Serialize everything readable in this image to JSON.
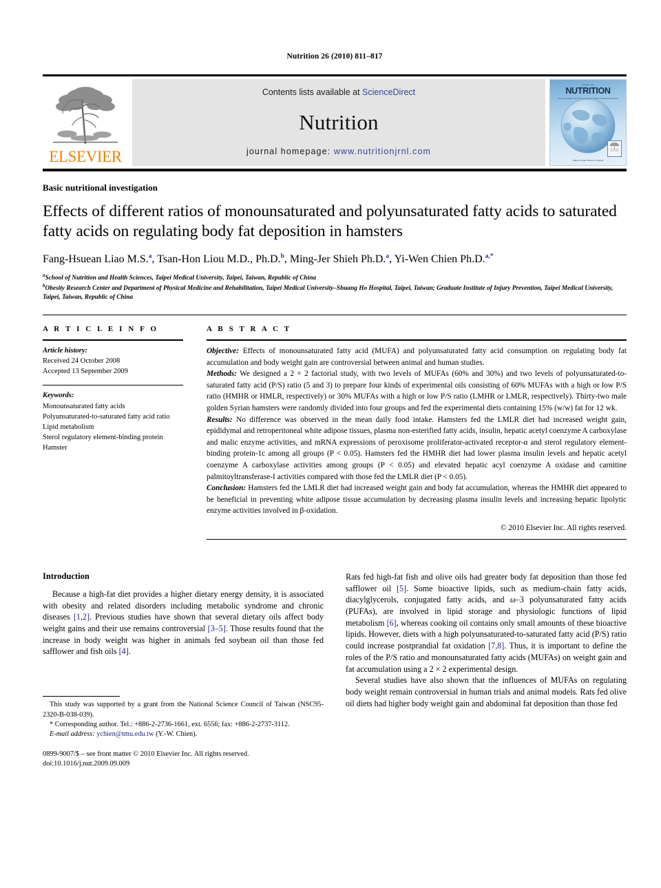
{
  "running_head": "Nutrition 26 (2010) 811–817",
  "masthead": {
    "publisher_name": "ELSEVIER",
    "contents_prefix": "Contents lists available at ",
    "contents_link": "ScienceDirect",
    "journal_title": "Nutrition",
    "homepage_prefix": "journal homepage: ",
    "homepage_url": "www.nutritionjrnl.com",
    "cover": {
      "top_label": "Volume 26",
      "title": "NUTRITION",
      "subtitle": "The International Journal of Applied and Basic Nutritional Sciences",
      "bottom_label": "Editor-in-Chief: Michel M. Meguid",
      "publisher_mark": "ELSEVIER"
    },
    "colors": {
      "link": "#33449b",
      "elsevier_orange": "#F08000",
      "masthead_gray": "#e4e4e4",
      "cover_blue": "#6fa8d8"
    }
  },
  "article": {
    "section_label": "Basic nutritional investigation",
    "title": "Effects of different ratios of monounsaturated and polyunsaturated fatty acids to saturated fatty acids on regulating body fat deposition in hamsters",
    "authors": [
      {
        "name": "Fang-Hsuean Liao M.S.",
        "marks": "a",
        "sep": ", "
      },
      {
        "name": "Tsan-Hon Liou M.D., Ph.D.",
        "marks": "b",
        "sep": ", "
      },
      {
        "name": "Ming-Jer Shieh Ph.D.",
        "marks": "a",
        "sep": ", "
      },
      {
        "name": "Yi-Wen Chien Ph.D.",
        "marks": "a,*",
        "sep": ""
      }
    ],
    "affiliations": [
      {
        "mark": "a",
        "text": "School of Nutrition and Health Sciences, Taipei Medical University, Taipei, Taiwan, Republic of China"
      },
      {
        "mark": "b",
        "text": "Obesity Research Center and Department of Physical Medicine and Rehabilitation, Taipei Medical University–Shuang Ho Hospital, Taipei, Taiwan; Graduate Institute of Injury Prevention, Taipei Medical University, Taipei, Taiwan, Republic of China"
      }
    ]
  },
  "article_info": {
    "heading": "A R T I C L E  I N F O",
    "history_label": "Article history:",
    "history": [
      "Received 24 October 2008",
      "Accepted 13 September 2009"
    ],
    "keywords_label": "Keywords:",
    "keywords": [
      "Monounsaturated fatty acids",
      "Polyunsaturated-to-saturated fatty acid ratio",
      "Lipid metabolism",
      "Sterol regulatory element-binding protein",
      "Hamster"
    ]
  },
  "abstract": {
    "heading": "A B S T R A C T",
    "objective_label": "Objective:",
    "objective_text": " Effects of monounsaturated fatty acid (MUFA) and polyunsaturated fatty acid consumption on regulating body fat accumulation and body weight gain are controversial between animal and human studies.",
    "methods_label": "Methods:",
    "methods_text": " We designed a 2 × 2 factorial study, with two levels of MUFAs (60% and 30%) and two levels of polyunsaturated-to-saturated fatty acid (P/S) ratio (5 and 3) to prepare four kinds of experimental oils consisting of 60% MUFAs with a high or low P/S ratio (HMHR or HMLR, respectively) or 30% MUFAs with a high or low P/S ratio (LMHR or LMLR, respectively). Thirty-two male golden Syrian hamsters were randomly divided into four groups and fed the experimental diets containing 15% (w/w) fat for 12 wk.",
    "results_label": "Results:",
    "results_text": " No difference was observed in the mean daily food intake. Hamsters fed the LMLR diet had increased weight gain, epididymal and retroperitoneal white adipose tissues, plasma non-esterified fatty acids, insulin, hepatic acetyl coenzyme A carboxylase and malic enzyme activities, and mRNA expressions of peroxisome proliferator-activated receptor-α and sterol regulatory element-binding protein-1c among all groups (P < 0.05). Hamsters fed the HMHR diet had lower plasma insulin levels and hepatic acetyl coenzyme A carboxylase activities among groups (P < 0.05) and elevated hepatic acyl coenzyme A oxidase and carnitine palmitoyltransferase-I activities compared with those fed the LMLR diet (P < 0.05).",
    "conclusion_label": "Conclusion:",
    "conclusion_text": " Hamsters fed the LMLR diet had increased weight gain and body fat accumulation, whereas the HMHR diet appeared to be beneficial in preventing white adipose tissue accumulation by decreasing plasma insulin levels and increasing hepatic lipolytic enzyme activities involved in β-oxidation.",
    "copyright": "© 2010 Elsevier Inc. All rights reserved."
  },
  "introduction": {
    "heading": "Introduction",
    "left_paragraphs": [
      {
        "segments": [
          {
            "t": "Because a high-fat diet provides a higher dietary energy density, it is associated with obesity and related disorders including metabolic syndrome and chronic diseases ",
            "ref": false
          },
          {
            "t": "[1,2]",
            "ref": true
          },
          {
            "t": ". Previous studies have shown that several dietary oils affect body weight gains and their use remains controversial ",
            "ref": false
          },
          {
            "t": "[3–5]",
            "ref": true
          },
          {
            "t": ". Those results found that the increase in body weight was higher in animals fed soybean oil than those fed safflower and fish oils ",
            "ref": false
          },
          {
            "t": "[4]",
            "ref": true
          },
          {
            "t": ".",
            "ref": false
          }
        ]
      }
    ],
    "right_paragraphs": [
      {
        "indent": false,
        "segments": [
          {
            "t": "Rats fed high-fat fish and olive oils had greater body fat deposition than those fed safflower oil ",
            "ref": false
          },
          {
            "t": "[5]",
            "ref": true
          },
          {
            "t": ". Some bioactive lipids, such as medium-chain fatty acids, diacylglycerols, conjugated fatty acids, and ω–3 polyunsaturated fatty acids (PUFAs), are involved in lipid storage and physiologic functions of lipid metabolism ",
            "ref": false
          },
          {
            "t": "[6]",
            "ref": true
          },
          {
            "t": ", whereas cooking oil contains only small amounts of these bioactive lipids. However, diets with a high polyunsaturated-to-saturated fatty acid (P/S) ratio could increase postprandial fat oxidation ",
            "ref": false
          },
          {
            "t": "[7,8]",
            "ref": true
          },
          {
            "t": ". Thus, it is important to define the roles of the P/S ratio and monounsaturated fatty acids (MUFAs) on weight gain and fat accumulation using a 2 × 2 experimental design.",
            "ref": false
          }
        ]
      },
      {
        "indent": true,
        "segments": [
          {
            "t": "Several studies have also shown that the influences of MUFAs on regulating body weight remain controversial in human trials and animal models. Rats fed olive oil diets had higher body weight gain and abdominal fat deposition than those fed",
            "ref": false
          }
        ]
      }
    ]
  },
  "footnotes": {
    "grant": "This study was supported by a grant from the National Science Council of Taiwan (NSC95-2320-B-038-039).",
    "corresponding": "* Corresponding author. Tel.: +886-2-2736-1661, ext. 6556; fax: +886-2-2737-3112.",
    "email_label": "E-mail address:",
    "email": "ychien@tmu.edu.tw",
    "email_owner": "(Y.-W. Chien).",
    "imprint_line1": "0899-9007/$ – see front matter © 2010 Elsevier Inc. All rights reserved.",
    "imprint_line2": "doi:10.1016/j.nut.2009.09.009"
  }
}
